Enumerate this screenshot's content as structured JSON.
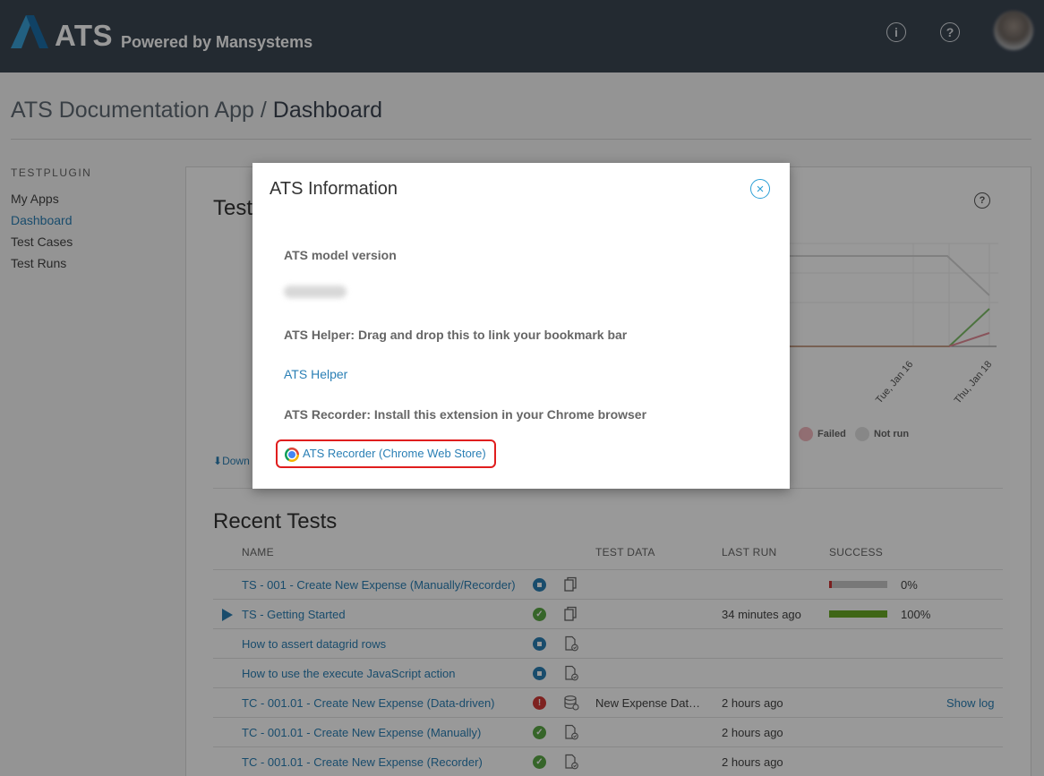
{
  "header": {
    "logo_text": "ATS",
    "logo_sub": "Powered by Mansystems",
    "info_icon": "info-icon",
    "help_icon": "help-icon"
  },
  "breadcrumb": {
    "app": "ATS Documentation App /",
    "page": "Dashboard"
  },
  "sidebar": {
    "section": "TESTPLUGIN",
    "items": [
      {
        "label": "My Apps"
      },
      {
        "label": "Dashboard"
      },
      {
        "label": "Test Cases"
      },
      {
        "label": "Test Runs"
      }
    ]
  },
  "dashboard": {
    "test_title_partial": "Test",
    "download_partial": "Down",
    "chart_ticks": [
      "Tue, Jan 16",
      "Thu, Jan 18"
    ],
    "legend": [
      {
        "label": "Failed",
        "color": "#f2b8be"
      },
      {
        "label": "Not run",
        "color": "#e2e2e2"
      }
    ]
  },
  "recent": {
    "title": "Recent Tests",
    "columns": {
      "name": "NAME",
      "test_data": "TEST DATA",
      "last_run": "LAST RUN",
      "success": "SUCCESS"
    },
    "rows": [
      {
        "name": "TS - 001 - Create New Expense (Manually/Recorder)",
        "status": "blue",
        "doc": "copy",
        "test_data": "",
        "last_run": "",
        "success_pct": "0%",
        "success_value": 0.05,
        "bar_color": "#cc3333",
        "show_log": ""
      },
      {
        "name": "TS - Getting Started",
        "status": "green",
        "doc": "copy",
        "test_data": "",
        "last_run": "34 minutes ago",
        "success_pct": "100%",
        "success_value": 1.0,
        "bar_color": "#6aaa26",
        "show_log": "",
        "selected": true
      },
      {
        "name": "How to assert datagrid rows",
        "status": "blue",
        "doc": "doc-check",
        "test_data": "",
        "last_run": "",
        "success_pct": "",
        "show_log": ""
      },
      {
        "name": "How to use the execute JavaScript action",
        "status": "blue",
        "doc": "doc-check",
        "test_data": "",
        "last_run": "",
        "success_pct": "",
        "show_log": ""
      },
      {
        "name": "TC - 001.01 - Create New Expense (Data-driven)",
        "status": "red",
        "doc": "database",
        "test_data": "New Expense Dat…",
        "last_run": "2 hours ago",
        "success_pct": "",
        "show_log": "Show log"
      },
      {
        "name": "TC - 001.01 - Create New Expense (Manually)",
        "status": "green",
        "doc": "doc-check",
        "test_data": "",
        "last_run": "2 hours ago",
        "success_pct": "",
        "show_log": ""
      },
      {
        "name": "TC - 001.01 - Create New Expense (Recorder)",
        "status": "green",
        "doc": "doc-check",
        "test_data": "",
        "last_run": "2 hours ago",
        "success_pct": "",
        "show_log": ""
      }
    ]
  },
  "modal": {
    "title": "ATS Information",
    "close_symbol": "×",
    "model_version_label": "ATS model version",
    "helper_label": "ATS Helper: Drag and drop this to link your bookmark bar",
    "helper_link": "ATS Helper",
    "recorder_label": "ATS Recorder: Install this extension in your Chrome browser",
    "recorder_link": "ATS Recorder (Chrome Web Store)"
  }
}
